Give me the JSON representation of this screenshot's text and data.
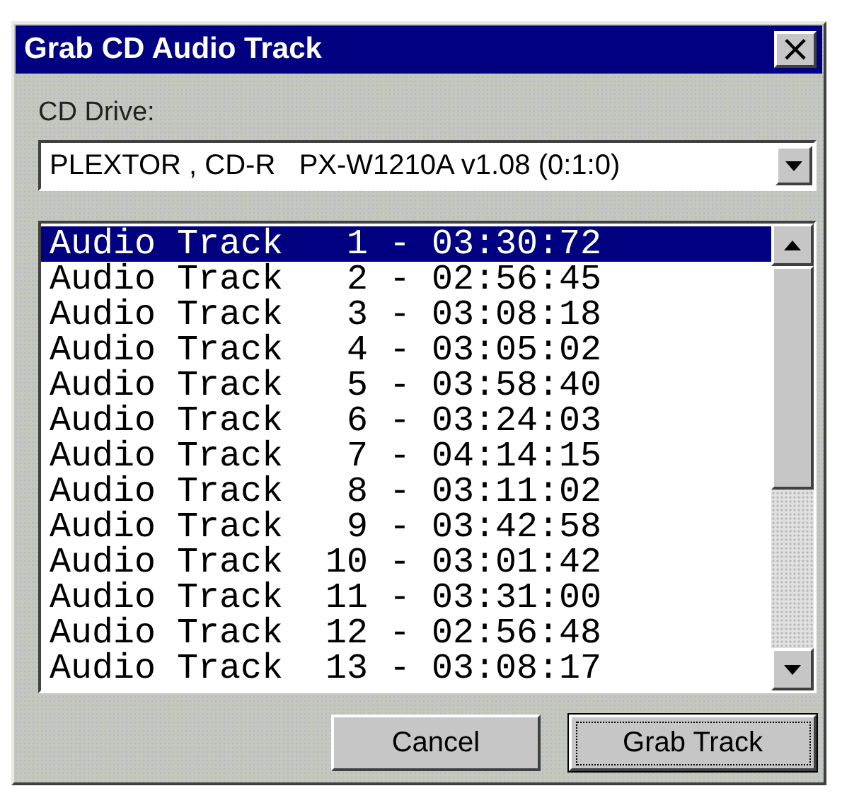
{
  "window": {
    "title": "Grab CD Audio Track",
    "close": "×"
  },
  "drive": {
    "label": "CD Drive:",
    "value": "PLEXTOR , CD-R   PX-W1210A v1.08 (0:1:0)"
  },
  "tracks": [
    {
      "text": "Audio Track   1 - 03:30:72",
      "selected": true
    },
    {
      "text": "Audio Track   2 - 02:56:45",
      "selected": false
    },
    {
      "text": "Audio Track   3 - 03:08:18",
      "selected": false
    },
    {
      "text": "Audio Track   4 - 03:05:02",
      "selected": false
    },
    {
      "text": "Audio Track   5 - 03:58:40",
      "selected": false
    },
    {
      "text": "Audio Track   6 - 03:24:03",
      "selected": false
    },
    {
      "text": "Audio Track   7 - 04:14:15",
      "selected": false
    },
    {
      "text": "Audio Track   8 - 03:11:02",
      "selected": false
    },
    {
      "text": "Audio Track   9 - 03:42:58",
      "selected": false
    },
    {
      "text": "Audio Track  10 - 03:01:42",
      "selected": false
    },
    {
      "text": "Audio Track  11 - 03:31:00",
      "selected": false
    },
    {
      "text": "Audio Track  12 - 02:56:48",
      "selected": false
    },
    {
      "text": "Audio Track  13 - 03:08:17",
      "selected": false
    }
  ],
  "buttons": [
    {
      "label": "Cancel",
      "default": false
    },
    {
      "label": "Grab Track",
      "default": true
    }
  ]
}
